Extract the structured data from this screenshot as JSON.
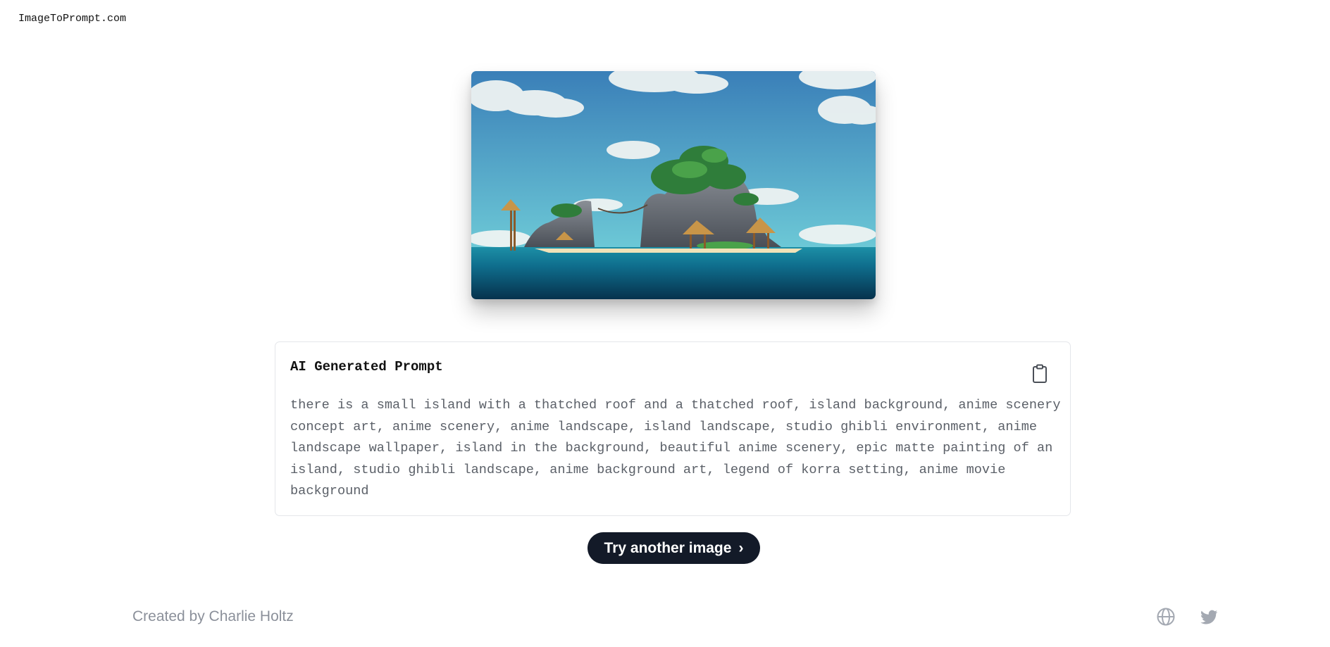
{
  "site": {
    "logo_text": "ImageToPrompt.com"
  },
  "hero_image": {
    "alt": "island landscape image",
    "palette": {
      "sky_top": "#3a7fb8",
      "sky_bottom": "#6cc8d6",
      "sea": "#0f6f8e",
      "sea_deep": "#06324d"
    }
  },
  "prompt_card": {
    "title": "AI Generated Prompt",
    "copy_icon": "clipboard-icon",
    "text": "there is a small island with a thatched roof and a thatched roof, island background, anime scenery concept art, anime scenery, anime landscape, island landscape, studio ghibli environment, anime landscape wallpaper, island in the background, beautiful anime scenery, epic matte painting of an island, studio ghibli landscape, anime background art, legend of korra setting, anime movie background"
  },
  "actions": {
    "try_another_label": "Try another image",
    "try_another_chevron": "›"
  },
  "footer": {
    "credit": "Created by Charlie Holtz",
    "icons": [
      "globe-icon",
      "twitter-icon"
    ]
  },
  "colors": {
    "button_bg": "#131a28",
    "muted_text": "#8b909a",
    "card_border": "#e4e6ea"
  }
}
